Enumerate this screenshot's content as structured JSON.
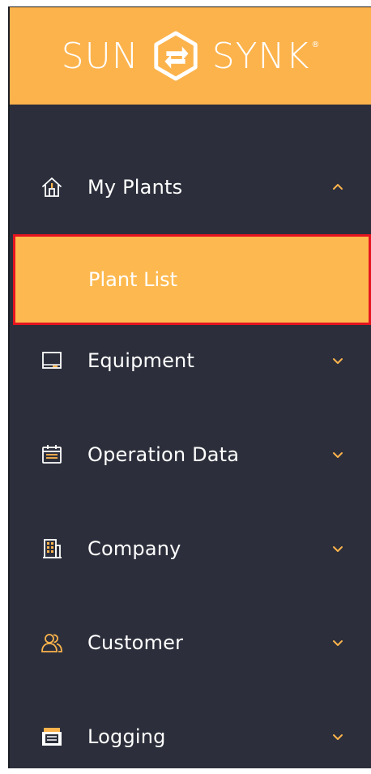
{
  "brand": {
    "left_text": "SUN",
    "right_text": "SYNK",
    "registered": "®",
    "accent_color": "#fcb34c",
    "logo_icon": "sunsynk-hexagon-arrows-icon"
  },
  "sidebar": {
    "background": "#2c2f3b",
    "items": [
      {
        "label": "My Plants",
        "icon": "house-icon",
        "expanded": true
      },
      {
        "label": "Equipment",
        "icon": "monitor-icon",
        "expanded": false
      },
      {
        "label": "Operation Data",
        "icon": "calendar-icon",
        "expanded": false
      },
      {
        "label": "Company",
        "icon": "building-icon",
        "expanded": false
      },
      {
        "label": "Customer",
        "icon": "users-icon",
        "expanded": false
      },
      {
        "label": "Logging",
        "icon": "log-stack-icon",
        "expanded": false
      }
    ],
    "submenu": {
      "parent": "My Plants",
      "items": [
        {
          "label": "Plant List",
          "selected": true
        }
      ]
    }
  },
  "highlight_color": "#e5141f"
}
